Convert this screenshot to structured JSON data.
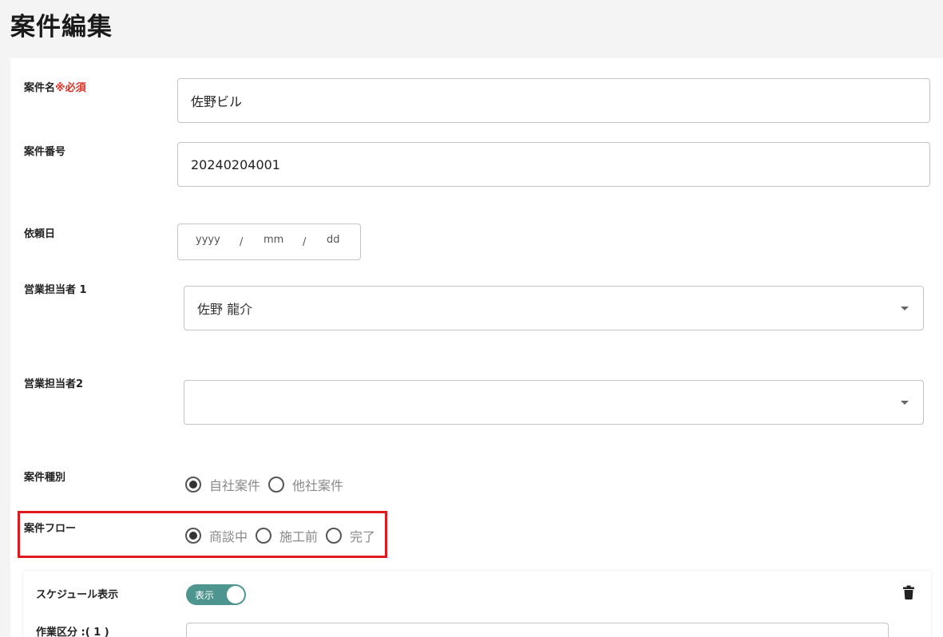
{
  "page": {
    "title": "案件編集"
  },
  "fields": {
    "case_name": {
      "label": "案件名",
      "required_mark": "※必須",
      "value": "佐野ビル"
    },
    "case_number": {
      "label": "案件番号",
      "value": "20240204001"
    },
    "request_date": {
      "label": "依頼日",
      "yyyy": "yyyy",
      "sep1": "/",
      "mm": "mm",
      "sep2": "/",
      "dd": "dd"
    },
    "sales_rep1": {
      "label": "営業担当者 1",
      "value": "佐野 龍介"
    },
    "sales_rep2": {
      "label": "営業担当者2",
      "value": ""
    },
    "case_type": {
      "label": "案件種別",
      "options": [
        "自社案件",
        "他社案件"
      ],
      "selected": "自社案件"
    },
    "case_flow": {
      "label": "案件フロー",
      "options": [
        "商談中",
        "施工前",
        "完了"
      ],
      "selected": "商談中"
    }
  },
  "schedule": {
    "label": "スケジュール表示",
    "toggle_label": "表示",
    "toggle_on": true,
    "work_category_label": "作業区分 :( 1 )"
  },
  "icons": {
    "delete": "trash-icon",
    "dropdown": "caret-down-icon"
  },
  "colors": {
    "required": "#d93025",
    "toggle": "#4e9590",
    "highlight": "#e0191f"
  }
}
